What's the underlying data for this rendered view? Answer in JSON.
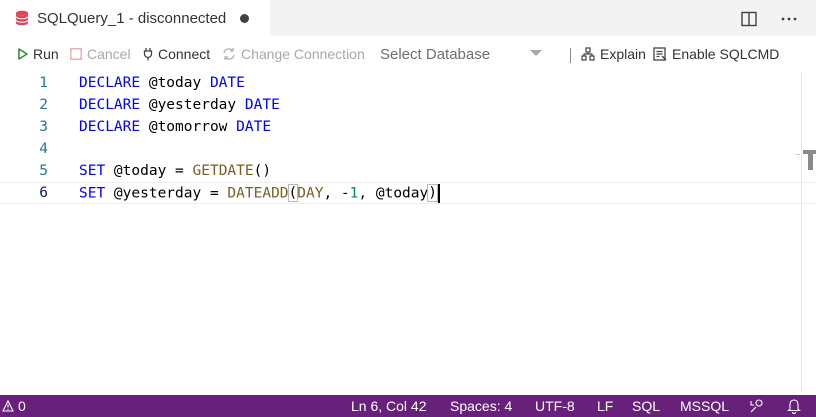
{
  "tab": {
    "title": "SQLQuery_1 - disconnected",
    "icon": "database-icon",
    "dirty": true
  },
  "tab_actions": [
    {
      "name": "split-editor-icon"
    },
    {
      "name": "more-actions-icon"
    }
  ],
  "toolbar": {
    "run_label": "Run",
    "cancel_label": "Cancel",
    "connect_label": "Connect",
    "change_connection_label": "Change Connection",
    "select_database_label": "Select Database",
    "explain_label": "Explain",
    "sqlcmd_label": "Enable SQLCMD"
  },
  "editor": {
    "lines": [
      {
        "number": "1"
      },
      {
        "number": "2"
      },
      {
        "number": "3"
      },
      {
        "number": "4"
      },
      {
        "number": "5"
      },
      {
        "number": "6"
      }
    ],
    "tokens": {
      "l1_kw": "DECLARE",
      "l1_var": " @today ",
      "l1_type": "DATE",
      "l2_kw": "DECLARE",
      "l2_var": " @yesterday ",
      "l2_type": "DATE",
      "l3_kw": "DECLARE",
      "l3_var": " @tomorrow ",
      "l3_type": "DATE",
      "l5_kw": "SET",
      "l5_var": " @today = ",
      "l5_fn": "GETDATE",
      "l5_paren": "()",
      "l6_kw": "SET",
      "l6_var": " @yesterday = ",
      "l6_fn": "DATEADD",
      "l6_open": "(",
      "l6_arg1": "DAY",
      "l6_sep1": ", -",
      "l6_num": "1",
      "l6_sep2": ", @today",
      "l6_close": ")"
    }
  },
  "statusbar": {
    "problems_count": "0",
    "position": "Ln 6, Col 42",
    "spaces": "Spaces: 4",
    "encoding": "UTF-8",
    "eol": "LF",
    "language": "SQL",
    "provider": "MSSQL"
  },
  "colors": {
    "statusbar": "#68217a",
    "run": "#388a34",
    "cancel": "#e8a9a9",
    "keyword": "#0000ff",
    "function": "#795e26",
    "number": "#098658",
    "line_number": "#237893",
    "db_icon": "#e0445b"
  }
}
